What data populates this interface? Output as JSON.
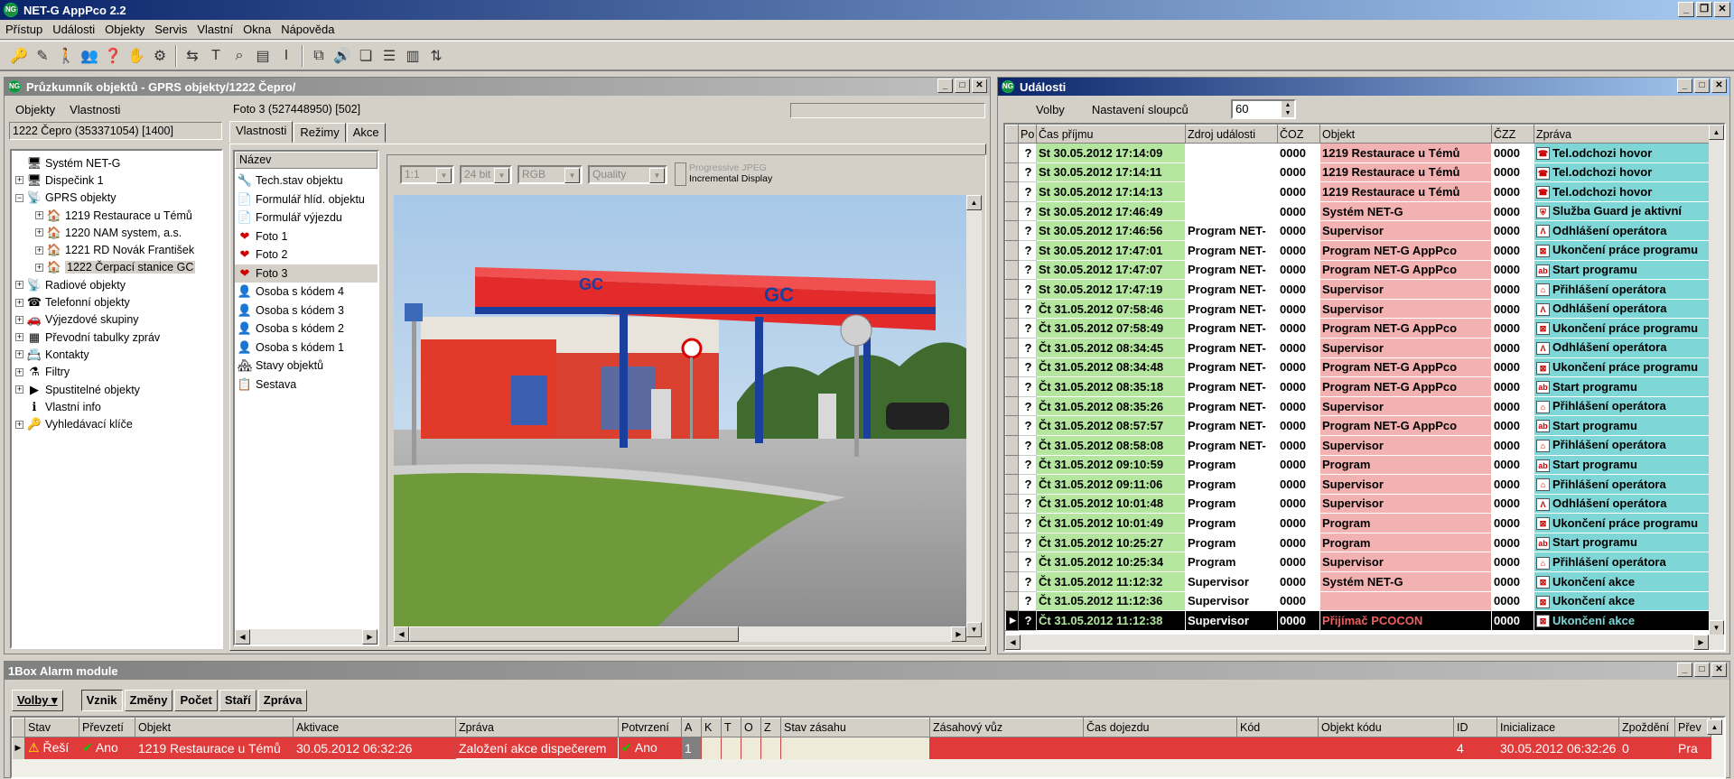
{
  "window": {
    "title": "NET-G AppPco 2.2"
  },
  "menu": [
    "Přístup",
    "Události",
    "Objekty",
    "Servis",
    "Vlastní",
    "Okna",
    "Nápověda"
  ],
  "explorer": {
    "title": "Průzkumník objektů - GPRS objekty/1222 Čepro/",
    "menu": [
      "Objekty",
      "Vlastnosti"
    ],
    "current": "1222 Čepro  (353371054) [1400]",
    "selected_item": "Foto 3  (527448950) [502]",
    "tree": [
      {
        "label": "Systém NET-G",
        "icon": "computer-icon",
        "level": 0,
        "exp": ""
      },
      {
        "label": "Dispečink 1",
        "icon": "computer-icon",
        "level": 0,
        "exp": "+"
      },
      {
        "label": "GPRS objekty",
        "icon": "antenna-icon",
        "level": 0,
        "exp": "−"
      },
      {
        "label": "1219 Restaurace u Témů",
        "icon": "house-icon",
        "level": 1,
        "exp": "+"
      },
      {
        "label": "1220 NAM system, a.s.",
        "icon": "house-icon",
        "level": 1,
        "exp": "+"
      },
      {
        "label": "1221 RD Novák František",
        "icon": "house-icon",
        "level": 1,
        "exp": "+"
      },
      {
        "label": "1222 Čerpací stanice GC",
        "icon": "house-icon",
        "level": 1,
        "exp": "+",
        "sel": true
      },
      {
        "label": "Radiové objekty",
        "icon": "antenna-icon",
        "level": 0,
        "exp": "+"
      },
      {
        "label": "Telefonní objekty",
        "icon": "phone-icon",
        "level": 0,
        "exp": "+"
      },
      {
        "label": "Výjezdové skupiny",
        "icon": "car-icon",
        "level": 0,
        "exp": "+"
      },
      {
        "label": "Převodní tabulky zpráv",
        "icon": "table-icon",
        "level": 0,
        "exp": "+"
      },
      {
        "label": "Kontakty",
        "icon": "contact-icon",
        "level": 0,
        "exp": "+"
      },
      {
        "label": "Filtry",
        "icon": "filter-icon",
        "level": 0,
        "exp": "+"
      },
      {
        "label": "Spustitelné objekty",
        "icon": "run-icon",
        "level": 0,
        "exp": "+"
      },
      {
        "label": "Vlastní info",
        "icon": "info-icon",
        "level": 0,
        "exp": ""
      },
      {
        "label": "Vyhledávací klíče",
        "icon": "key-icon",
        "level": 0,
        "exp": "+"
      }
    ],
    "tabs": [
      "Vlastnosti",
      "Režimy",
      "Akce"
    ],
    "list_header": "Název",
    "list": [
      {
        "label": "Tech.stav objektu",
        "icon": "tech-icon"
      },
      {
        "label": "Formulář hlíd. objektu",
        "icon": "form-icon"
      },
      {
        "label": "Formulář výjezdu",
        "icon": "form-icon"
      },
      {
        "label": "Foto 1",
        "icon": "photo-icon"
      },
      {
        "label": "Foto 2",
        "icon": "photo-icon"
      },
      {
        "label": "Foto 3",
        "icon": "photo-icon",
        "sel": true
      },
      {
        "label": "Osoba s kódem 4",
        "icon": "person-icon"
      },
      {
        "label": "Osoba s kódem 3",
        "icon": "person-icon"
      },
      {
        "label": "Osoba s kódem 2",
        "icon": "person-icon"
      },
      {
        "label": "Osoba s kódem 1",
        "icon": "person-icon"
      },
      {
        "label": "Stavy objektů",
        "icon": "states-icon"
      },
      {
        "label": "Sestava",
        "icon": "report-icon"
      }
    ],
    "image_opts": {
      "zoom": "1:1",
      "bits": "24 bit",
      "color": "RGB",
      "quality": "Quality",
      "progressive": "Progressive JPEG",
      "incremental": "Incremental Display"
    },
    "canopy_logo": "GC"
  },
  "events": {
    "title": "Události",
    "menu": [
      "Volby",
      "Nastavení sloupců"
    ],
    "count": "60",
    "columns": [
      "Po",
      "Čas příjmu",
      "Zdroj události",
      "ČOZ",
      "Objekt",
      "ČZZ",
      "Zpráva"
    ],
    "rows": [
      {
        "po": "?",
        "time": "St 30.05.2012 17:14:09",
        "src": "",
        "coz": "0000",
        "obj": "1219 Restaurace u Témů",
        "czz": "0000",
        "msg": "Tel.odchozi hovor",
        "ic": "tel-icon"
      },
      {
        "po": "?",
        "time": "St 30.05.2012 17:14:11",
        "src": "",
        "coz": "0000",
        "obj": "1219 Restaurace u Témů",
        "czz": "0000",
        "msg": "Tel.odchozi hovor",
        "ic": "tel-icon"
      },
      {
        "po": "?",
        "time": "St 30.05.2012 17:14:13",
        "src": "",
        "coz": "0000",
        "obj": "1219 Restaurace u Témů",
        "czz": "0000",
        "msg": "Tel.odchozi hovor",
        "ic": "tel-icon"
      },
      {
        "po": "?",
        "time": "St 30.05.2012 17:46:49",
        "src": "",
        "coz": "0000",
        "obj": "Systém NET-G",
        "czz": "0000",
        "msg": "Služba Guard je aktivní",
        "ic": "guard-icon"
      },
      {
        "po": "?",
        "time": "St 30.05.2012 17:46:56",
        "src": "Program NET-",
        "coz": "0000",
        "obj": "Supervisor",
        "czz": "0000",
        "msg": "Odhlášení operátora",
        "ic": "logout-icon"
      },
      {
        "po": "?",
        "time": "St 30.05.2012 17:47:01",
        "src": "Program NET-",
        "coz": "0000",
        "obj": "Program NET-G AppPco",
        "czz": "0000",
        "msg": "Ukončení práce programu",
        "ic": "end-icon"
      },
      {
        "po": "?",
        "time": "St 30.05.2012 17:47:07",
        "src": "Program NET-",
        "coz": "0000",
        "obj": "Program NET-G AppPco",
        "czz": "0000",
        "msg": "Start programu",
        "ic": "start-icon"
      },
      {
        "po": "?",
        "time": "St 30.05.2012 17:47:19",
        "src": "Program NET-",
        "coz": "0000",
        "obj": "Supervisor",
        "czz": "0000",
        "msg": "Přihlášení operátora",
        "ic": "login-icon"
      },
      {
        "po": "?",
        "time": "Čt 31.05.2012 07:58:46",
        "src": "Program NET-",
        "coz": "0000",
        "obj": "Supervisor",
        "czz": "0000",
        "msg": "Odhlášení operátora",
        "ic": "logout-icon"
      },
      {
        "po": "?",
        "time": "Čt 31.05.2012 07:58:49",
        "src": "Program NET-",
        "coz": "0000",
        "obj": "Program NET-G AppPco",
        "czz": "0000",
        "msg": "Ukončení práce programu",
        "ic": "end-icon"
      },
      {
        "po": "?",
        "time": "Čt 31.05.2012 08:34:45",
        "src": "Program NET-",
        "coz": "0000",
        "obj": "Supervisor",
        "czz": "0000",
        "msg": "Odhlášení operátora",
        "ic": "logout-icon"
      },
      {
        "po": "?",
        "time": "Čt 31.05.2012 08:34:48",
        "src": "Program NET-",
        "coz": "0000",
        "obj": "Program NET-G AppPco",
        "czz": "0000",
        "msg": "Ukončení práce programu",
        "ic": "end-icon"
      },
      {
        "po": "?",
        "time": "Čt 31.05.2012 08:35:18",
        "src": "Program NET-",
        "coz": "0000",
        "obj": "Program NET-G AppPco",
        "czz": "0000",
        "msg": "Start programu",
        "ic": "start-icon"
      },
      {
        "po": "?",
        "time": "Čt 31.05.2012 08:35:26",
        "src": "Program NET-",
        "coz": "0000",
        "obj": "Supervisor",
        "czz": "0000",
        "msg": "Přihlášení operátora",
        "ic": "login-icon"
      },
      {
        "po": "?",
        "time": "Čt 31.05.2012 08:57:57",
        "src": "Program NET-",
        "coz": "0000",
        "obj": "Program NET-G AppPco",
        "czz": "0000",
        "msg": "Start programu",
        "ic": "start-icon"
      },
      {
        "po": "?",
        "time": "Čt 31.05.2012 08:58:08",
        "src": "Program NET-",
        "coz": "0000",
        "obj": "Supervisor",
        "czz": "0000",
        "msg": "Přihlášení operátora",
        "ic": "login-icon"
      },
      {
        "po": "?",
        "time": "Čt 31.05.2012 09:10:59",
        "src": "Program",
        "coz": "0000",
        "obj": "Program",
        "czz": "0000",
        "msg": "Start programu",
        "ic": "start-icon"
      },
      {
        "po": "?",
        "time": "Čt 31.05.2012 09:11:06",
        "src": "Program",
        "coz": "0000",
        "obj": "Supervisor",
        "czz": "0000",
        "msg": "Přihlášení operátora",
        "ic": "login-icon"
      },
      {
        "po": "?",
        "time": "Čt 31.05.2012 10:01:48",
        "src": "Program",
        "coz": "0000",
        "obj": "Supervisor",
        "czz": "0000",
        "msg": "Odhlášení operátora",
        "ic": "logout-icon"
      },
      {
        "po": "?",
        "time": "Čt 31.05.2012 10:01:49",
        "src": "Program",
        "coz": "0000",
        "obj": "Program",
        "czz": "0000",
        "msg": "Ukončení práce programu",
        "ic": "end-icon"
      },
      {
        "po": "?",
        "time": "Čt 31.05.2012 10:25:27",
        "src": "Program",
        "coz": "0000",
        "obj": "Program",
        "czz": "0000",
        "msg": "Start programu",
        "ic": "start-icon"
      },
      {
        "po": "?",
        "time": "Čt 31.05.2012 10:25:34",
        "src": "Program",
        "coz": "0000",
        "obj": "Supervisor",
        "czz": "0000",
        "msg": "Přihlášení operátora",
        "ic": "login-icon"
      },
      {
        "po": "?",
        "time": "Čt 31.05.2012 11:12:32",
        "src": "Supervisor",
        "coz": "0000",
        "obj": "Systém NET-G",
        "czz": "0000",
        "msg": "Ukončení akce",
        "ic": "end-icon"
      },
      {
        "po": "?",
        "time": "Čt 31.05.2012 11:12:36",
        "src": "Supervisor",
        "coz": "0000",
        "obj": "",
        "czz": "0000",
        "msg": "Ukončení akce",
        "ic": "end-icon"
      },
      {
        "po": "?",
        "time": "Čt 31.05.2012 11:12:38",
        "src": "Supervisor",
        "coz": "0000",
        "obj": "Přijímač PCOCON",
        "czz": "0000",
        "msg": "Ukončení akce",
        "ic": "end-icon",
        "hl": true
      }
    ]
  },
  "alarm": {
    "title": "1Box Alarm module",
    "buttons": [
      "Volby",
      "Vznik",
      "Změny",
      "Počet",
      "Staří",
      "Zpráva"
    ],
    "active_button": "Vznik",
    "columns": [
      "Stav",
      "Převzetí",
      "Objekt",
      "Aktivace",
      "Zpráva",
      "Potvrzení",
      "A",
      "K",
      "T",
      "O",
      "Z",
      "Stav zásahu",
      "Zásahový vůz",
      "Čas dojezdu",
      "Kód",
      "Objekt kódu",
      "ID",
      "Inicializace",
      "Zpoždění",
      "Přev"
    ],
    "row": {
      "stav": "Řeší",
      "prevzeti": "Ano",
      "objekt": "1219 Restaurace u Témů",
      "aktivace": "30.05.2012 06:32:26",
      "zprava": "Založení akce dispečerem",
      "potvrzeni": "Ano",
      "a": "1",
      "k": "",
      "t": "",
      "o": "",
      "z": "",
      "stav_zasahu": "",
      "vuz": "",
      "dojezd": "",
      "kod": "",
      "obj_kodu": "",
      "id": "4",
      "init": "30.05.2012 06:32:26",
      "zpozdeni": "0",
      "prev": "Pra"
    }
  },
  "colors": {
    "green": "#b4e6a0",
    "pink": "#f2b2b2",
    "teal": "#7fd6d6",
    "alarm": "#e03a3a",
    "title": "#0a246a"
  }
}
